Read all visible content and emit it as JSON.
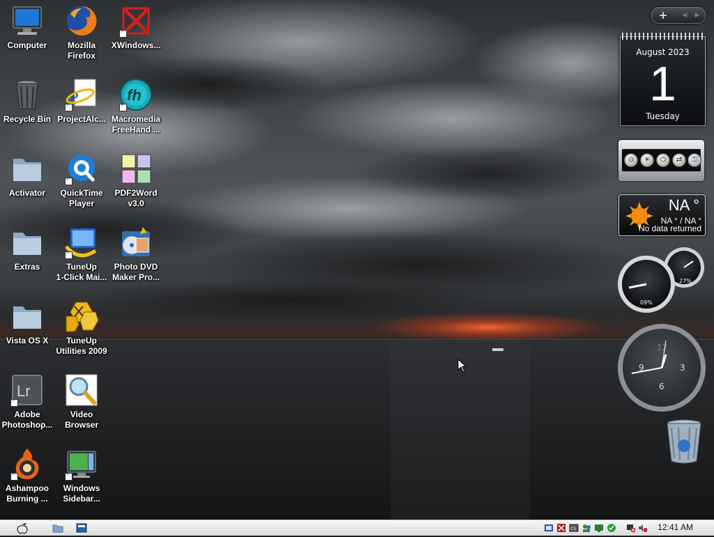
{
  "desktop_icons": [
    {
      "id": "computer",
      "label": "Computer"
    },
    {
      "id": "firefox",
      "label": "Mozilla\nFirefox"
    },
    {
      "id": "xwindows",
      "label": "XWindows..."
    },
    {
      "id": "recycle",
      "label": "Recycle Bin"
    },
    {
      "id": "projectalc",
      "label": "ProjectAlc..."
    },
    {
      "id": "freehand",
      "label": "Macromedia\nFreeHand ..."
    },
    {
      "id": "activator",
      "label": "Activator"
    },
    {
      "id": "quicktime",
      "label": "QuickTime\nPlayer"
    },
    {
      "id": "pdf2word",
      "label": "PDF2Word\nv3.0"
    },
    {
      "id": "extras",
      "label": "Extras"
    },
    {
      "id": "tuneup1click",
      "label": "TuneUp\n1-Click Mai..."
    },
    {
      "id": "photodvd",
      "label": "Photo DVD\nMaker Pro..."
    },
    {
      "id": "vistaosx",
      "label": "Vista OS X"
    },
    {
      "id": "tuneup2009",
      "label": "TuneUp\nUtilities 2009"
    },
    {
      "id": "photoshop",
      "label": "Adobe\nPhotoshop..."
    },
    {
      "id": "videobrowser",
      "label": "Video\nBrowser"
    },
    {
      "id": "ashampoo",
      "label": "Ashampoo\nBurning ..."
    },
    {
      "id": "winsidebar",
      "label": "Windows\nSidebar..."
    }
  ],
  "sidebar": {
    "add_label": "+",
    "prev_label": "◀",
    "next_label": "▶",
    "calendar": {
      "month": "August 2023",
      "day": "1",
      "weekday": "Tuesday"
    },
    "weather": {
      "temp": "NA °",
      "range": "NA ° / NA °",
      "status": "No data returned"
    },
    "meters": {
      "cpu": "09%",
      "memory": "27%"
    },
    "clock": {
      "n12": "12",
      "n3": "3",
      "n6": "6",
      "n9": "9"
    }
  },
  "taskbar": {
    "clock": "12:41 AM"
  },
  "colors": {
    "sky_dark": "#2b2d30",
    "sunset": "#ff5a28",
    "taskbar": "#e9e9e9"
  }
}
